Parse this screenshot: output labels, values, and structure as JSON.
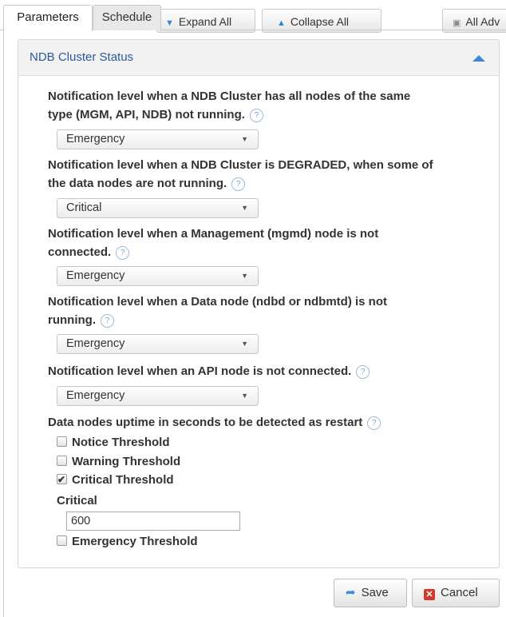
{
  "tabs": [
    {
      "label": "Parameters",
      "active": true
    },
    {
      "label": "Schedule",
      "active": false
    }
  ],
  "toolbar": {
    "expand_all": "Expand All",
    "collapse_all": "Collapse All",
    "all_adv": "All Adv"
  },
  "panel": {
    "title": "NDB Cluster Status",
    "icons": {
      "collapse": "chevron-up-icon",
      "help": "question-icon"
    }
  },
  "fields": [
    {
      "label_line1": "Notification level when a NDB Cluster has all nodes of the same",
      "label_line2": "type (MGM, API, NDB) not running.",
      "value": "Emergency"
    },
    {
      "label_line1": "Notification level when a NDB Cluster is DEGRADED, when some of",
      "label_line2": "the data nodes are not running.",
      "value": "Critical"
    },
    {
      "label_line1": "Notification level when a Management (mgmd) node is not",
      "label_line2": "connected.",
      "value": "Emergency"
    },
    {
      "label_line1": "Notification level when a Data node (ndbd or ndbmtd) is not",
      "label_line2": "running.",
      "value": "Emergency"
    },
    {
      "label_line1": "Notification level when an API node is not connected.",
      "label_line2": "",
      "value": "Emergency"
    }
  ],
  "uptime": {
    "label": "Data nodes uptime in seconds to be detected as restart",
    "thresholds": [
      {
        "label": "Notice Threshold",
        "checked": false
      },
      {
        "label": "Warning Threshold",
        "checked": false
      },
      {
        "label": "Critical Threshold",
        "checked": true
      },
      {
        "label": "Emergency Threshold",
        "checked": false
      }
    ],
    "critical_label": "Critical",
    "critical_value": "600"
  },
  "buttons": {
    "save": "Save",
    "cancel": "Cancel"
  },
  "colors": {
    "accent": "#3a8ad8",
    "title": "#2a5a9c",
    "danger": "#d23a2c"
  }
}
